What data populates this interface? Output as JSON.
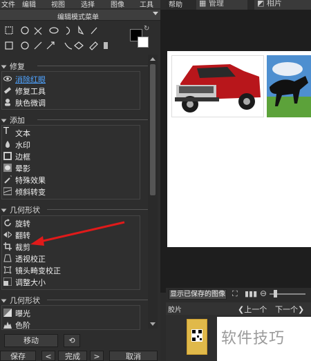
{
  "menubar": {
    "items": [
      "文件",
      "编辑",
      "视图",
      "选择",
      "图像",
      "工具"
    ],
    "help": "帮助",
    "tab_manage": "管理",
    "tab_photo": "相片"
  },
  "panel": {
    "mode_title": "编辑模式菜单",
    "sections": [
      {
        "title": "修复",
        "items": [
          "消除红眼",
          "修复工具",
          "肤色微调"
        ]
      },
      {
        "title": "添加",
        "items": [
          "文本",
          "水印",
          "边框",
          "晕影",
          "特殊效果",
          "倾斜转变"
        ]
      },
      {
        "title": "几何形状",
        "items": [
          "旋转",
          "翻转",
          "裁剪",
          "透视校正",
          "镜头畸变校正",
          "调整大小"
        ]
      },
      {
        "title": "几何形状",
        "items": [
          "曝光",
          "色阶"
        ]
      }
    ],
    "move_button": "移动",
    "save_button": "保存",
    "done_button": "完成",
    "cancel_button": "取消",
    "nav_prev": "<",
    "nav_next": ">"
  },
  "viewer": {
    "show_saved": "显示已保存的图像",
    "film_label": "胶片",
    "prev": "上一个",
    "next": "下一个",
    "watermark": "软件技巧"
  },
  "colors": {
    "accent_link": "#4fa3ff",
    "arrow": "#e01a1a"
  }
}
